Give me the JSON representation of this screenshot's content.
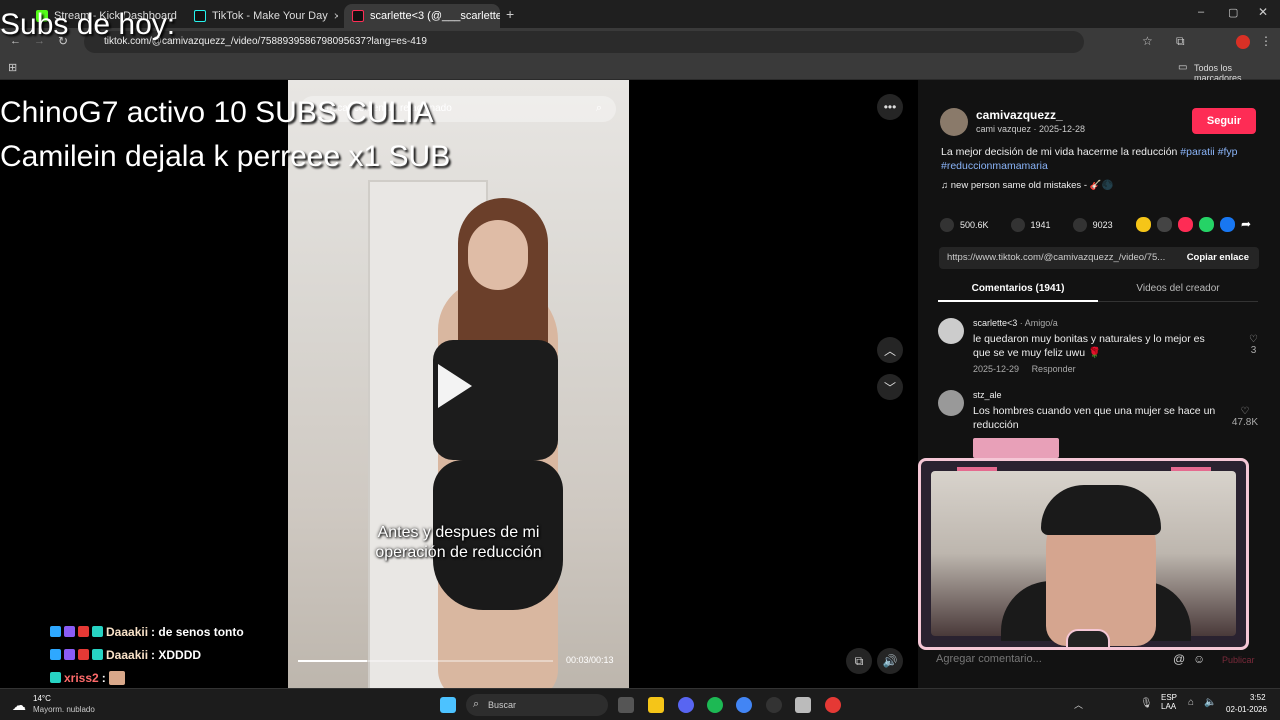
{
  "browser": {
    "tabs": [
      {
        "label": "Stream - Kick Dashboard"
      },
      {
        "label": "TikTok - Make Your Day"
      },
      {
        "label": "scarlette<3 (@___scarlette___)"
      }
    ],
    "url": "tiktok.com/@camivazquezz_/video/7588939586798095637?lang=es-419",
    "bookmarks_label": "Todos los marcadores"
  },
  "overlay": {
    "subs_title": "Subs de hoy:",
    "line1": "ChinoG7 activo 10 SUBS CULIA",
    "line2": "Camilein dejala k perreee x1 SUB"
  },
  "video": {
    "search_placeholder": "Buscar contenido relacionado",
    "caption_line1": "Antes y despues de mi",
    "caption_line2": "operación de reducción",
    "time": "00:03/00:13",
    "progress": 0.27
  },
  "panel": {
    "username": "camivazquezz_",
    "subtitle": "cami vazquez · 2025-12-28",
    "follow_label": "Seguir",
    "description": "La mejor decisión de mi vida hacerme la reducción",
    "hashtags": "#paratii #fyp #reduccionmamamaria",
    "music": "new person same old mistakes - 🎸🌑",
    "likes": "500.6K",
    "comments_count": "1941",
    "saves": "9023",
    "share_url": "https://www.tiktok.com/@camivazquezz_/video/75...",
    "copy_label": "Copiar enlace",
    "tab_comments": "Comentarios (1941)",
    "tab_creator": "Videos del creador",
    "comments": [
      {
        "user": "scarlette<3",
        "tag": "· Amigo/a",
        "text": "le quedaron muy bonitas y naturales y lo mejor es que se ve muy feliz uwu 🌹",
        "date": "2025-12-29",
        "reply": "Responder",
        "likes": "3"
      },
      {
        "user": "stz_ale",
        "text": "Los hombres cuando ven que una mujer se hace un reducción",
        "likes": "47.8K"
      }
    ],
    "add_comment_placeholder": "Agregar comentario...",
    "publish_label": "Publicar"
  },
  "chat": [
    {
      "user": "Daaakii",
      "message": ": de senos tonto"
    },
    {
      "user": "Daaakii",
      "message": ": XDDDD"
    },
    {
      "user": "xriss2",
      "message": ":"
    }
  ],
  "taskbar": {
    "weather_temp": "14°C",
    "weather_desc": "Mayorm. nublado",
    "search_placeholder": "Buscar",
    "lang1": "ESP",
    "lang2": "LAA",
    "time": "3:52",
    "date": "02-01-2026"
  },
  "colors": {
    "follow": "#fe2c55",
    "hashtag": "#8ab4f8",
    "chat_user": "#f9e2c8",
    "chat_user2": "#ff6b6b"
  }
}
